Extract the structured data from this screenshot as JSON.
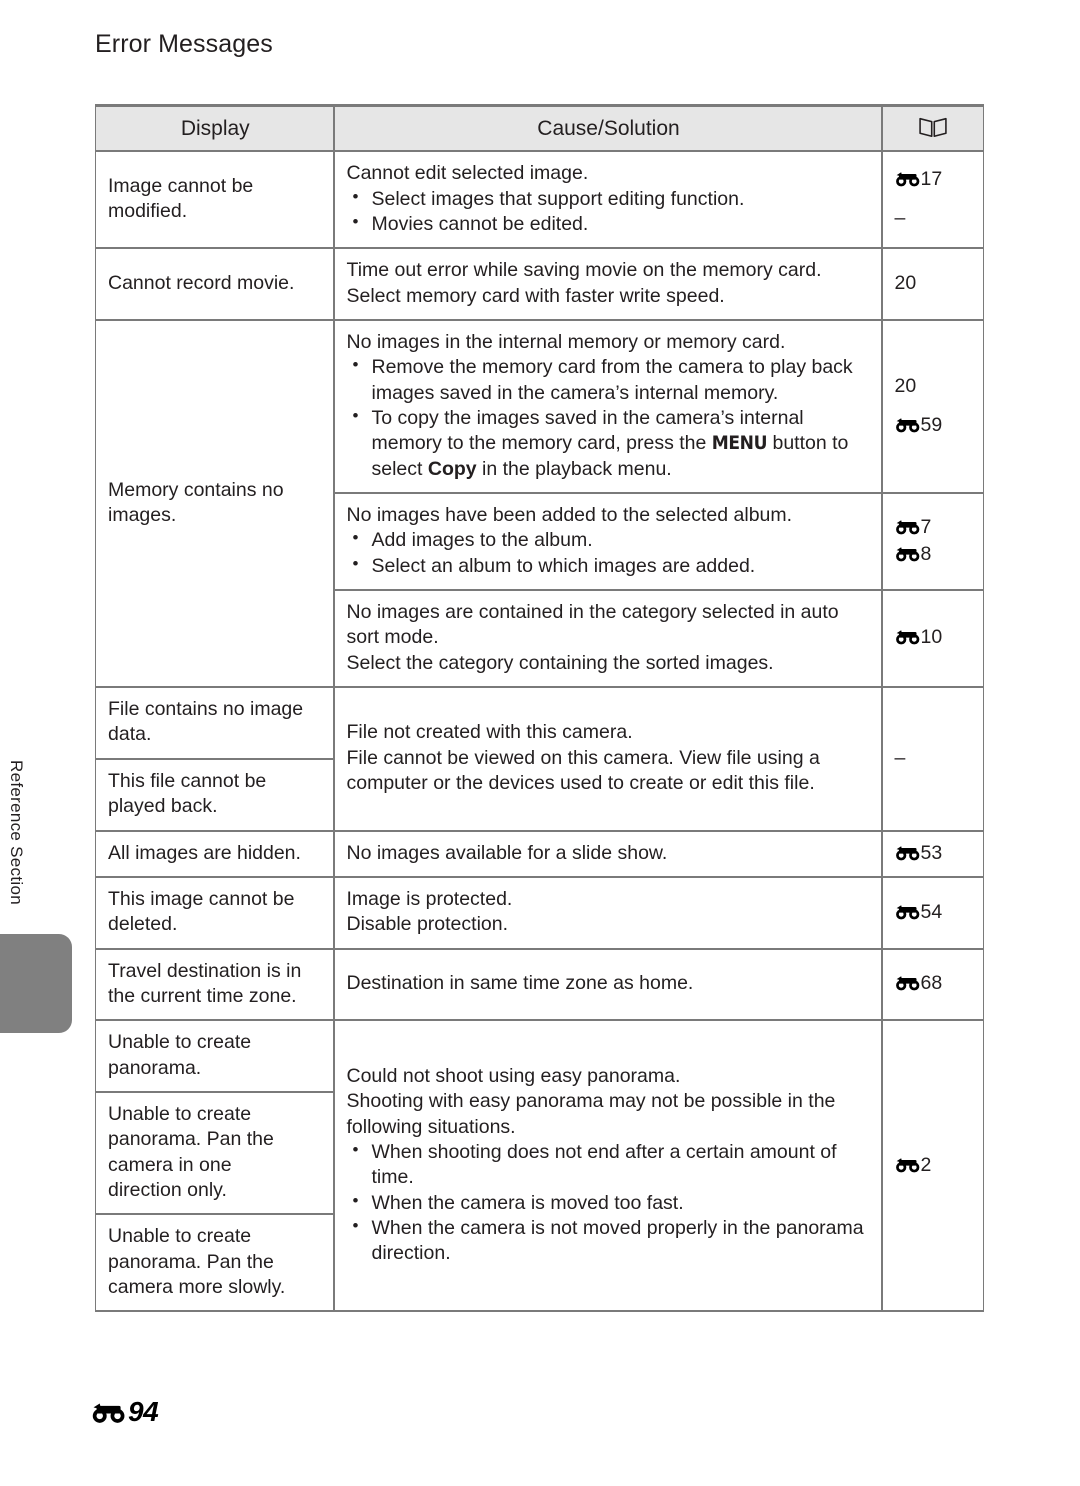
{
  "page": {
    "title": "Error Messages",
    "side_label": "Reference Section",
    "footer_page": "94",
    "footer_icon": "e-reference-icon"
  },
  "table": {
    "headers": {
      "display": "Display",
      "cause_solution": "Cause/Solution",
      "reference_icon": "open-book-icon"
    },
    "rows": [
      {
        "display": [
          "Image cannot be",
          "modified."
        ],
        "cause_lead": "Cannot edit selected image.",
        "cause_bullets": [
          "Select images that support editing function.",
          "Movies cannot be edited."
        ],
        "refs": [
          {
            "icon": "e-reference-icon",
            "num": "17"
          },
          {
            "icon": "",
            "num": "–"
          }
        ]
      },
      {
        "display": [
          "Cannot record movie."
        ],
        "cause_lines": [
          "Time out error while saving movie on the memory card.",
          "Select memory card with faster write speed."
        ],
        "refs": [
          {
            "icon": "",
            "num": "20"
          }
        ]
      },
      {
        "display": [
          "Memory contains no",
          "images."
        ],
        "cause_lead": "No images in the internal memory or memory card.",
        "cause_bullets": [
          "Remove the memory card from the camera to play back images saved in the camera’s internal memory.",
          "To copy the images saved in the camera’s internal memory to the memory card, press the MENU button to select Copy in the playback menu."
        ],
        "refs": [
          {
            "icon": "",
            "num": "20"
          },
          {
            "icon": "e-reference-icon",
            "num": "59"
          }
        ]
      },
      {
        "cause_lead": "No images have been added to the selected album.",
        "cause_bullets": [
          "Add images to the album.",
          "Select an album to which images are added."
        ],
        "refs": [
          {
            "icon": "e-reference-icon",
            "num": "7"
          },
          {
            "icon": "e-reference-icon",
            "num": "8"
          }
        ]
      },
      {
        "cause_lines": [
          "No images are contained in the category selected in auto sort mode.",
          "Select the category containing the sorted images."
        ],
        "refs": [
          {
            "icon": "e-reference-icon",
            "num": "10"
          }
        ]
      },
      {
        "display": [
          "File contains no image",
          "data."
        ],
        "display2": [
          "This file cannot be",
          "played back."
        ],
        "cause_lines": [
          "File not created with this camera.",
          "File cannot be viewed on this camera. View file using a computer or the devices used to create or edit this file."
        ],
        "refs": [
          {
            "icon": "",
            "num": "–"
          }
        ]
      },
      {
        "display": [
          "All images are hidden."
        ],
        "cause_lines": [
          "No images available for a slide show."
        ],
        "refs": [
          {
            "icon": "e-reference-icon",
            "num": "53"
          }
        ]
      },
      {
        "display": [
          "This image cannot be",
          "deleted."
        ],
        "cause_lines": [
          "Image is protected.",
          "Disable protection."
        ],
        "refs": [
          {
            "icon": "e-reference-icon",
            "num": "54"
          }
        ]
      },
      {
        "display": [
          "Travel destination is in",
          "the current time zone."
        ],
        "cause_lines": [
          "Destination in same time zone as home."
        ],
        "refs": [
          {
            "icon": "e-reference-icon",
            "num": "68"
          }
        ]
      },
      {
        "display": [
          "Unable to create",
          "panorama."
        ],
        "display2": [
          "Unable to create",
          "panorama. Pan the",
          "camera in one",
          "direction only."
        ],
        "display3": [
          "Unable to create",
          "panorama. Pan the",
          "camera more slowly."
        ],
        "cause_lead": "Could not shoot using easy panorama.",
        "cause_lead2": "Shooting with easy panorama may not be possible in the following situations.",
        "cause_bullets": [
          "When shooting does not end after a certain amount of time.",
          "When the camera is moved too fast.",
          "When the camera is not moved properly in the panorama direction."
        ],
        "refs": [
          {
            "icon": "e-reference-icon",
            "num": "2"
          }
        ]
      }
    ]
  },
  "colors": {
    "rule": "#7a7a7a",
    "header_fill": "#e6e6e6",
    "tab_gray": "#808080",
    "text": "#231f20"
  }
}
